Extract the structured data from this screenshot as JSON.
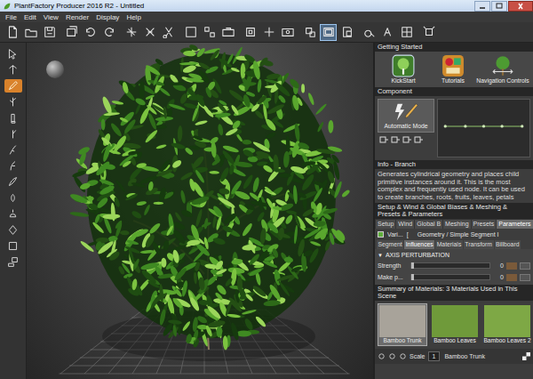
{
  "window": {
    "title": "PlantFactory Producer 2016 R2 - Untitled"
  },
  "menu": [
    "File",
    "Edit",
    "View",
    "Render",
    "Display",
    "Help"
  ],
  "toolbar": [
    {
      "selected": false
    },
    {
      "selected": false
    },
    {
      "selected": false
    },
    {
      "selected": false
    },
    {
      "selected": false
    },
    {
      "selected": false
    },
    {
      "selected": false
    },
    {
      "selected": false
    },
    {
      "selected": false
    },
    {
      "selected": false
    },
    {
      "selected": false
    },
    {
      "selected": false
    },
    {
      "selected": false
    },
    {
      "selected": false
    },
    {
      "selected": false
    },
    {
      "selected": false
    },
    {
      "selected": true
    },
    {
      "selected": false
    },
    {
      "selected": false
    },
    {
      "selected": false
    },
    {
      "selected": false
    },
    {
      "selected": false
    }
  ],
  "tools": [
    {
      "selected": false
    },
    {
      "selected": false
    },
    {
      "selected": true
    },
    {
      "selected": false
    },
    {
      "selected": false
    },
    {
      "selected": false
    },
    {
      "selected": false
    },
    {
      "selected": false
    },
    {
      "selected": false
    },
    {
      "selected": false
    },
    {
      "selected": false
    },
    {
      "selected": false
    },
    {
      "selected": false
    },
    {
      "selected": false
    }
  ],
  "getting_started": {
    "title": "Getting Started",
    "items": [
      {
        "label": "KickStart"
      },
      {
        "label": "Tutorials"
      },
      {
        "label": "Navigation Controls"
      }
    ]
  },
  "component": {
    "title": "Component",
    "mode": "Automatic Mode"
  },
  "info": {
    "title": "Info - Branch",
    "text": "Generates cylindrical geometry and places child primitive instances around it. This is the most complex and frequently used node. It can be used to create branches, roots, fruits, leaves, petals"
  },
  "setup": {
    "title": "Setup & Wind & Global Biases & Meshing & Presets & Parameters",
    "tabs": [
      {
        "label": "Setup",
        "selected": false
      },
      {
        "label": "Wind",
        "selected": false
      },
      {
        "label": "Global B",
        "selected": false
      },
      {
        "label": "Meshing",
        "selected": false
      },
      {
        "label": "Presets",
        "selected": false
      },
      {
        "label": "Parameters",
        "selected": true
      }
    ],
    "node": {
      "name": "Vari...",
      "bracket": "[",
      "path": "Geometry / Simple Segment I"
    },
    "sub_tabs": [
      {
        "label": "Segment",
        "selected": false
      },
      {
        "label": "Influences",
        "selected": true
      },
      {
        "label": "Materials",
        "selected": false
      },
      {
        "label": "Transform",
        "selected": false
      },
      {
        "label": "Billboard",
        "selected": false
      }
    ],
    "section": {
      "toggle": "▼",
      "title": "AXIS PERTURBATION",
      "expanded": true
    },
    "params": [
      {
        "label": "Strength",
        "value": "0",
        "level": 0
      },
      {
        "label": "Make p...",
        "value": "0",
        "level": 0
      }
    ]
  },
  "materials": {
    "title": "Summary of Materials: 3 Materials Used in This Scene",
    "items": [
      {
        "label": "Bamboo Trunk",
        "selected": true,
        "color": "#a8a39a"
      },
      {
        "label": "Bamboo Leaves",
        "selected": false,
        "color": "#6f9a3a"
      },
      {
        "label": "Bamboo Leaves 2",
        "selected": false,
        "color": "#7ea845"
      }
    ]
  },
  "bottom_bar": {
    "scale_label": "Scale",
    "scale_value": "1",
    "material": "Bamboo Trunk"
  }
}
